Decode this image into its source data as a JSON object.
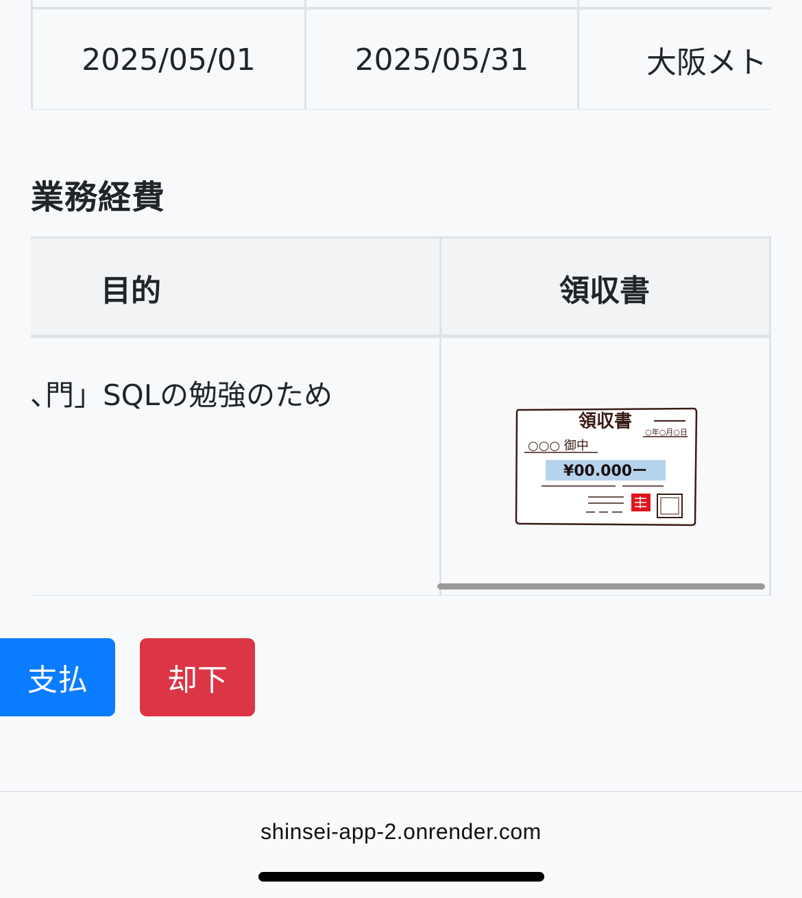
{
  "period_table": {
    "start_date": "2025/05/01",
    "end_date": "2025/05/31",
    "destination_partial": "大阪メト"
  },
  "business_expenses": {
    "section_title": "業務経費",
    "columns": {
      "purpose": "目的",
      "receipt": "領収書"
    },
    "rows": [
      {
        "purpose_visible": "､門」SQLの勉強のため",
        "receipt_image": {
          "title": "領収書",
          "date": "○年○月○日",
          "addressee": "○○○ 御中",
          "amount": "¥00.000ー",
          "stamp_color": "#e0141e"
        }
      }
    ]
  },
  "actions": {
    "pay_label": "支払",
    "reject_label": "却下",
    "pay_color": "#0a7cff",
    "reject_color": "#dc3545"
  },
  "browser": {
    "url": "shinsei-app-2.onrender.com"
  }
}
